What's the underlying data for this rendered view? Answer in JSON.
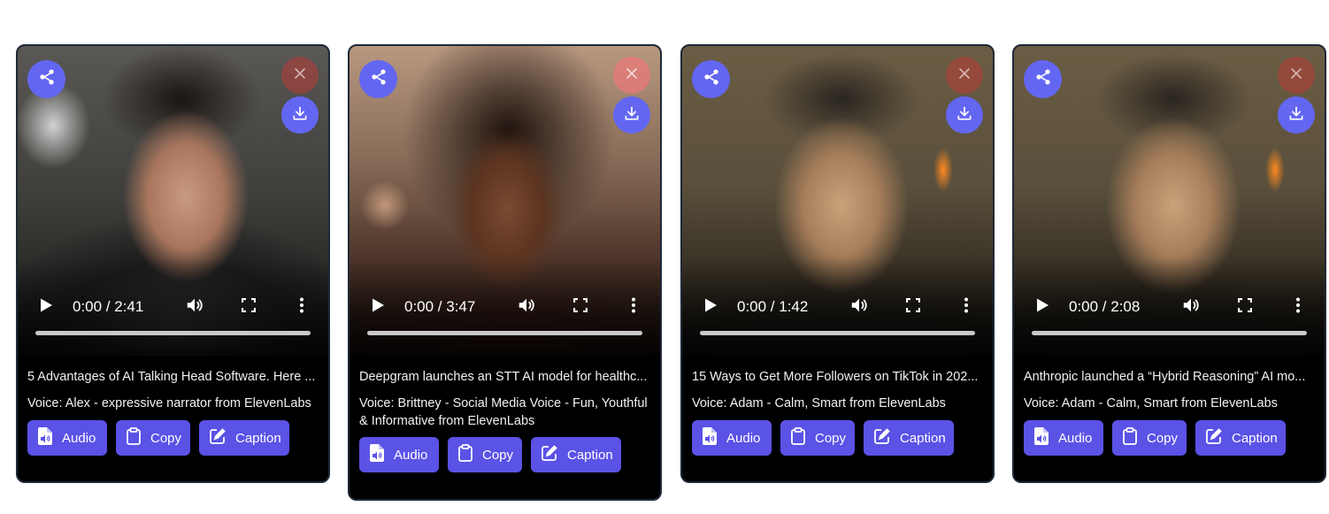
{
  "accent_color": "#5b52e6",
  "button_labels": {
    "audio": "Audio",
    "copy": "Copy",
    "caption": "Caption"
  },
  "cards": [
    {
      "time": "0:00 / 2:41",
      "progress": 0,
      "title": "5 Advantages of AI Talking Head Software. Here ...",
      "voice": "Voice: Alex - expressive narrator from ElevenLabs"
    },
    {
      "time": "0:00 / 3:47",
      "progress": 0,
      "title": "Deepgram launches an STT AI model for healthc...",
      "voice": "Voice: Brittney - Social Media Voice - Fun, Youthful & Informative from ElevenLabs"
    },
    {
      "time": "0:00 / 1:42",
      "progress": 0,
      "title": "15 Ways to Get More Followers on TikTok in 202...",
      "voice": "Voice: Adam - Calm, Smart from ElevenLabs"
    },
    {
      "time": "0:00 / 2:08",
      "progress": 0,
      "title": "Anthropic launched a “Hybrid Reasoning” AI mo...",
      "voice": "Voice: Adam - Calm, Smart from ElevenLabs"
    }
  ],
  "icons": {
    "share": "share-icon",
    "close": "close-icon",
    "download": "download-icon",
    "play": "play-icon",
    "volume": "volume-icon",
    "fullscreen": "fullscreen-icon",
    "more": "more-vertical-icon",
    "audio": "audio-file-icon",
    "copy": "clipboard-icon",
    "caption": "edit-icon"
  }
}
